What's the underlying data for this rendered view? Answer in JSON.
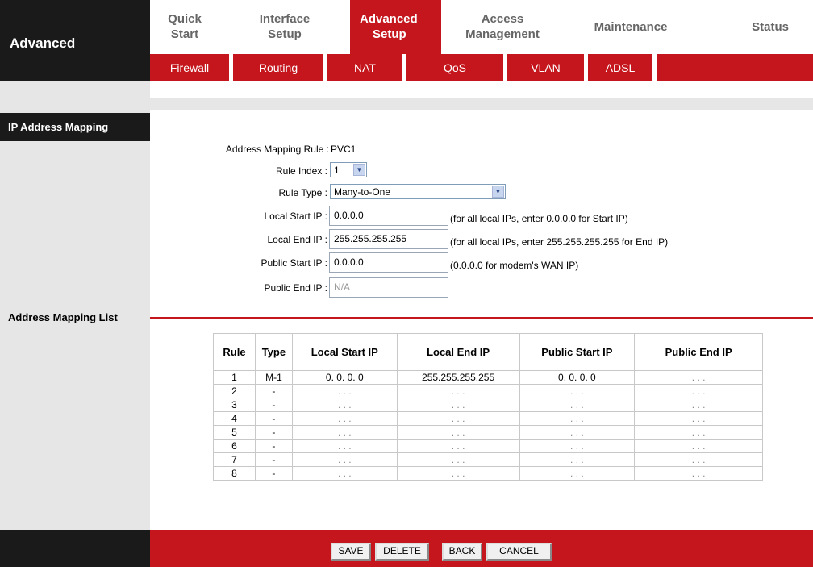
{
  "brand": {
    "title": "Advanced"
  },
  "topnav": [
    {
      "line1": "Quick",
      "line2": "Start"
    },
    {
      "line1": "Interface",
      "line2": "Setup"
    },
    {
      "line1": "Advanced",
      "line2": "Setup"
    },
    {
      "line1": "Access",
      "line2": "Management"
    },
    {
      "line1": "Maintenance",
      "line2": ""
    },
    {
      "line1": "Status",
      "line2": ""
    }
  ],
  "subnav": [
    "Firewall",
    "Routing",
    "NAT",
    "QoS",
    "VLAN",
    "ADSL"
  ],
  "section": {
    "title": "IP Address Mapping",
    "list_title": "Address Mapping List"
  },
  "form": {
    "rule_label": "Address Mapping Rule :",
    "rule_value": "PVC1",
    "index_label": "Rule Index :",
    "index_value": "1",
    "type_label": "Rule Type :",
    "type_value": "Many-to-One",
    "local_start_label": "Local Start IP :",
    "local_start_value": "0.0.0.0",
    "local_start_hint": "(for all local IPs, enter 0.0.0.0 for Start IP)",
    "local_end_label": "Local End IP :",
    "local_end_value": "255.255.255.255",
    "local_end_hint": "(for all local IPs, enter 255.255.255.255 for End IP)",
    "public_start_label": "Public Start IP :",
    "public_start_value": "0.0.0.0",
    "public_start_hint": "(0.0.0.0 for modem's WAN IP)",
    "public_end_label": "Public End IP :",
    "public_end_value": "N/A"
  },
  "table": {
    "headers": [
      "Rule",
      "Type",
      "Local Start IP",
      "Local End IP",
      "Public Start IP",
      "Public End IP"
    ],
    "rows": [
      [
        "1",
        "M-1",
        "0. 0. 0. 0",
        "255.255.255.255",
        "0. 0. 0. 0",
        ". . ."
      ],
      [
        "2",
        "-",
        ". . .",
        ". . .",
        ". . .",
        ". . ."
      ],
      [
        "3",
        "-",
        ". . .",
        ". . .",
        ". . .",
        ". . ."
      ],
      [
        "4",
        "-",
        ". . .",
        ". . .",
        ". . .",
        ". . ."
      ],
      [
        "5",
        "-",
        ". . .",
        ". . .",
        ". . .",
        ". . ."
      ],
      [
        "6",
        "-",
        ". . .",
        ". . .",
        ". . .",
        ". . ."
      ],
      [
        "7",
        "-",
        ". . .",
        ". . .",
        ". . .",
        ". . ."
      ],
      [
        "8",
        "-",
        ". . .",
        ". . .",
        ". . .",
        ". . ."
      ]
    ]
  },
  "buttons": {
    "save": "SAVE",
    "delete": "DELETE",
    "back": "BACK",
    "cancel": "CANCEL"
  },
  "colors": {
    "accent": "#c4161c",
    "dark": "#1a1a1a",
    "sidebar": "#e6e6e6"
  }
}
